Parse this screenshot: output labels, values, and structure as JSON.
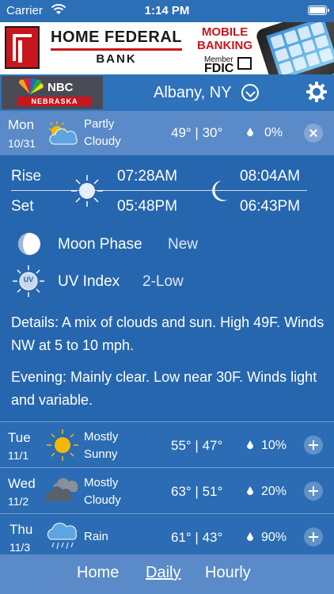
{
  "status_bar": {
    "carrier": "Carrier",
    "time": "1:14 PM"
  },
  "ad": {
    "bank_line1": "HOME FEDERAL",
    "bank_line2": "BANK",
    "mobile_line1": "MOBILE",
    "mobile_line2": "BANKING",
    "member": "Member",
    "fdic": "FDIC"
  },
  "header": {
    "nbc_text": "NBC",
    "nebraska_text": "NEBRASKA",
    "location": "Albany, NY"
  },
  "today": {
    "day": "Mon",
    "date": "10/31",
    "condition_line1": "Partly",
    "condition_line2": "Cloudy",
    "temps": "49° | 30°",
    "precip": "0%"
  },
  "details": {
    "rise_label": "Rise",
    "set_label": "Set",
    "sunrise": "07:28AM",
    "sunset": "05:48PM",
    "moonrise": "08:04AM",
    "moonset": "06:43PM",
    "moon_phase_label": "Moon Phase",
    "moon_phase_value": "New",
    "uv_label": "UV Index",
    "uv_value": "2-Low",
    "uv_icon_text": "UV",
    "details_text": "Details: A mix of clouds and sun. High 49F. Winds NW at 5 to 10 mph.",
    "evening_text": "Evening: Mainly clear. Low near 30F. Winds light and variable."
  },
  "forecast": [
    {
      "day": "Tue",
      "date": "11/1",
      "condition_line1": "Mostly",
      "condition_line2": "Sunny",
      "temps": "55° | 47°",
      "precip": "10%",
      "icon": "sun-icon"
    },
    {
      "day": "Wed",
      "date": "11/2",
      "condition_line1": "Mostly",
      "condition_line2": "Cloudy",
      "temps": "63° | 51°",
      "precip": "20%",
      "icon": "cloudy-icon"
    },
    {
      "day": "Thu",
      "date": "11/3",
      "condition_line1": "Rain",
      "condition_line2": "",
      "temps": "61° | 43°",
      "precip": "90%",
      "icon": "rain-icon"
    }
  ],
  "tabs": {
    "home": "Home",
    "daily": "Daily",
    "hourly": "Hourly"
  }
}
